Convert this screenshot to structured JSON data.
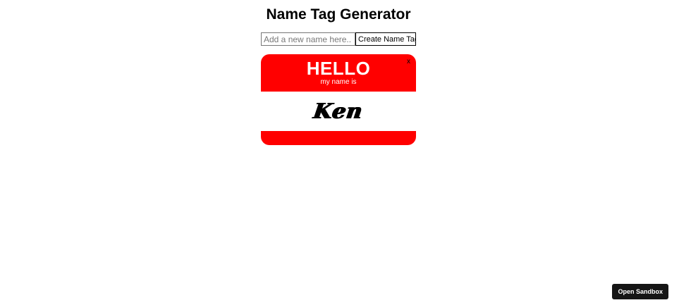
{
  "page": {
    "title": "Name Tag Generator"
  },
  "form": {
    "input_placeholder": "Add a new name here..",
    "input_value": "",
    "create_label": "Create Name Tag"
  },
  "tags": [
    {
      "greeting": "HELLO",
      "subtitle": "my name is",
      "name": "Ken",
      "remove_label": "x"
    }
  ],
  "sandbox": {
    "label": "Open Sandbox"
  },
  "colors": {
    "tag_red": "#ff0000",
    "sandbox_bg": "#151515"
  }
}
